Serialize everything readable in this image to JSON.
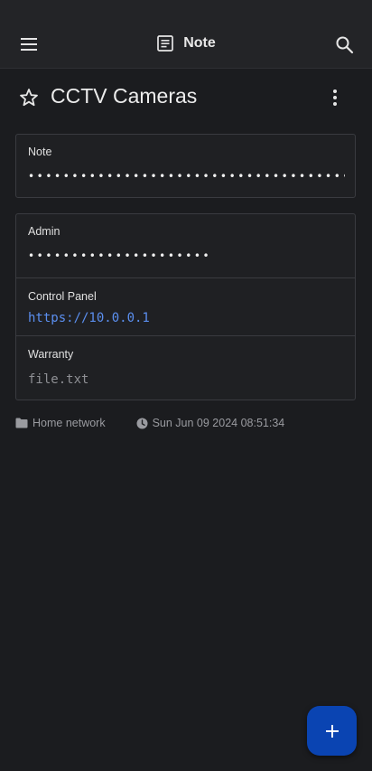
{
  "appbar": {
    "title": "Note",
    "icons": {
      "menu": "menu-icon",
      "note": "note-icon",
      "search": "search-icon"
    }
  },
  "entry": {
    "title": "CCTV Cameras",
    "favorite": false,
    "icons": {
      "star": "star-outline-icon",
      "more": "more-vert-icon"
    }
  },
  "note_card": {
    "label": "Note",
    "value": "••••••••••••••••••••••••••••••••••••••••"
  },
  "fields": [
    {
      "label": "Admin",
      "value": "•••••••••••••••••••••",
      "kind": "masked"
    },
    {
      "label": "Control Panel",
      "value": "https://10.0.0.1",
      "kind": "link"
    },
    {
      "label": "Warranty",
      "value": "file.txt",
      "kind": "file"
    }
  ],
  "meta": {
    "folder": "Home network",
    "timestamp": "Sun Jun 09 2024 08:51:34",
    "icons": {
      "folder": "folder-icon",
      "clock": "clock-icon"
    }
  },
  "fab": {
    "icon": "plus-icon",
    "color": "#0a44b2"
  },
  "colors": {
    "background": "#1b1c1f",
    "appbar": "#232427",
    "link": "#5b8ff0",
    "accent": "#0a44b2"
  }
}
